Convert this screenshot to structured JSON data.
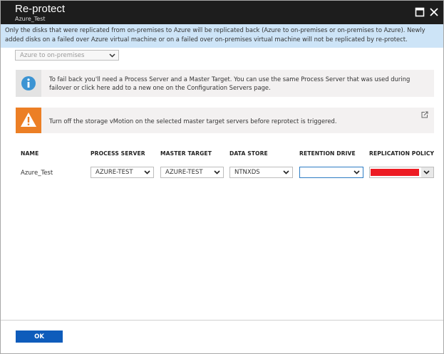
{
  "window": {
    "title": "Re-protect",
    "subtitle": "Azure_Test",
    "icons": [
      "maximize-icon",
      "close-icon"
    ]
  },
  "notice": {
    "text": "Only the disks that were replicated from on-premises to Azure will be replicated back (Azure to on-premises or on-premises to Azure). Newly added disks on a failed over Azure virtual machine or on a failed over on-premises virtual machine will not be replicated by re-protect."
  },
  "direction": {
    "selected": "Azure to on-premises"
  },
  "info_callout": {
    "icon": "info-icon",
    "text": "To fail back you'll need a Process Server and a Master Target. You can use the same Process Server that was used during failover or click here add to a new one on the Configuration Servers page."
  },
  "warning_callout": {
    "icon": "warning-icon",
    "text": "Turn off the storage vMotion on the selected master target servers before reprotect is triggered.",
    "link_icon": "external-link-icon"
  },
  "table": {
    "headers": {
      "name": "NAME",
      "process_server": "PROCESS SERVER",
      "master_target": "MASTER TARGET",
      "data_store": "DATA STORE",
      "retention_drive": "RETENTION DRIVE",
      "replication_policy": "REPLICATION POLICY"
    },
    "row": {
      "name": "Azure_Test",
      "process_server": "AZURE-TEST",
      "master_target": "AZURE-TEST",
      "data_store": "NTNXDS",
      "retention_drive": "",
      "replication_policy": ""
    }
  },
  "colors": {
    "titlebar": "#1d1d1d",
    "notice_bg": "#cde4f7",
    "info_blue": "#3c94d3",
    "warning_orange": "#ec7f25",
    "redacted": "#ed1c24",
    "primary_button": "#0e5cbb"
  },
  "footer": {
    "ok_label": "OK"
  }
}
